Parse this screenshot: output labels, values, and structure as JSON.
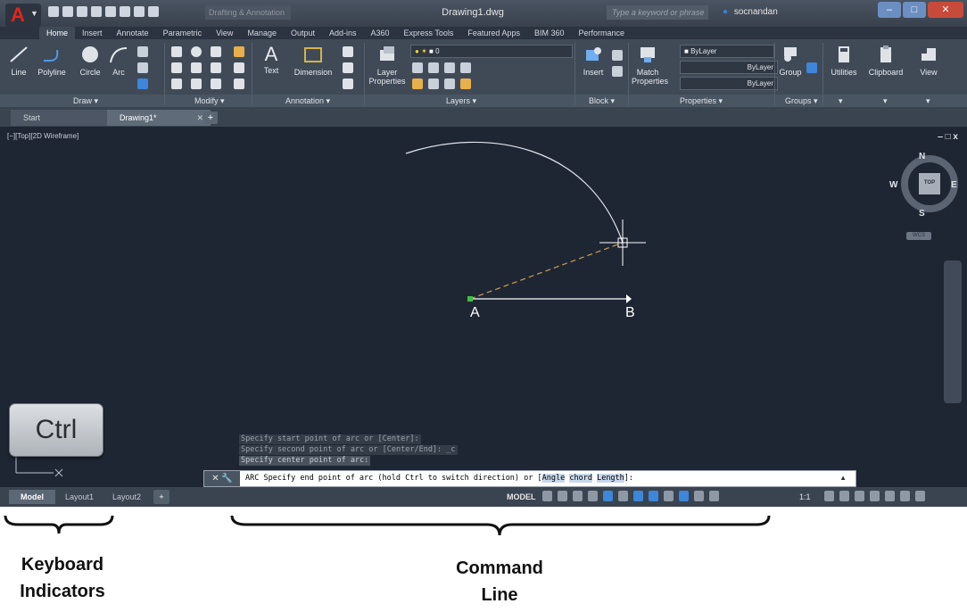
{
  "title_bar": {
    "workspace": "Drafting & Annotation",
    "document_title": "Drawing1.dwg",
    "search_placeholder": "Type a keyword or phrase",
    "username": "socnandan",
    "minimize_icon": "minimize-icon",
    "maximize_icon": "maximize-icon",
    "close_icon": "close-icon"
  },
  "ribbon_tabs": [
    "Home",
    "Insert",
    "Annotate",
    "Parametric",
    "View",
    "Manage",
    "Output",
    "Add-ins",
    "A360",
    "Express Tools",
    "Featured Apps",
    "BIM 360",
    "Performance"
  ],
  "ribbon": {
    "draw": {
      "title": "Draw",
      "tools": [
        "Line",
        "Polyline",
        "Circle",
        "Arc"
      ]
    },
    "modify": {
      "title": "Modify"
    },
    "annotation": {
      "title": "Annotation",
      "tools": [
        "Text",
        "Dimension"
      ]
    },
    "layers": {
      "title": "Layers",
      "layer_properties": "Layer Properties",
      "current_layer": "0"
    },
    "block": {
      "title": "Block",
      "insert": "Insert"
    },
    "properties": {
      "title": "Properties",
      "match_properties": "Match Properties",
      "color": "ByLayer",
      "linetype": "ByLayer",
      "lineweight": "ByLayer"
    },
    "groups": {
      "title": "Groups",
      "group": "Group"
    },
    "utilities": "Utilities",
    "clipboard": "Clipboard",
    "view": "View"
  },
  "doc_tabs": [
    "Start",
    "Drawing1*"
  ],
  "viewport": {
    "label": "[−][Top][2D Wireframe]",
    "controls": "‒ □ x",
    "navcube": {
      "north": "N",
      "south": "S",
      "east": "E",
      "west": "W",
      "face": "TOP",
      "ucs": "WCS"
    },
    "point_a": "A",
    "point_b": "B"
  },
  "command_history": [
    "Specify start point of arc or [Center]:",
    "Specify second point of arc or [Center/End]: _c",
    "Specify center point of arc:"
  ],
  "command_line": {
    "text": "ARC Specify end point of arc (hold Ctrl to switch direction) or [",
    "option1": "Angle",
    "option2": "chord",
    "option3": "Length",
    "suffix": "]:"
  },
  "status_bar": {
    "layout_tabs": [
      "Model",
      "Layout1",
      "Layout2"
    ],
    "model_indicator": "MODEL",
    "scale": "1:1"
  },
  "overlay": {
    "ctrl_key": "Ctrl",
    "label_left_1": "Keyboard",
    "label_left_2": "Indicators",
    "label_right_1": "Command",
    "label_right_2": "Line"
  },
  "colors": {
    "app_bg": "#2b3340",
    "canvas_bg": "#1f2633",
    "ribbon_bg": "#404a57",
    "accent_red": "#e1261c",
    "rubberband": "#c8a050"
  }
}
